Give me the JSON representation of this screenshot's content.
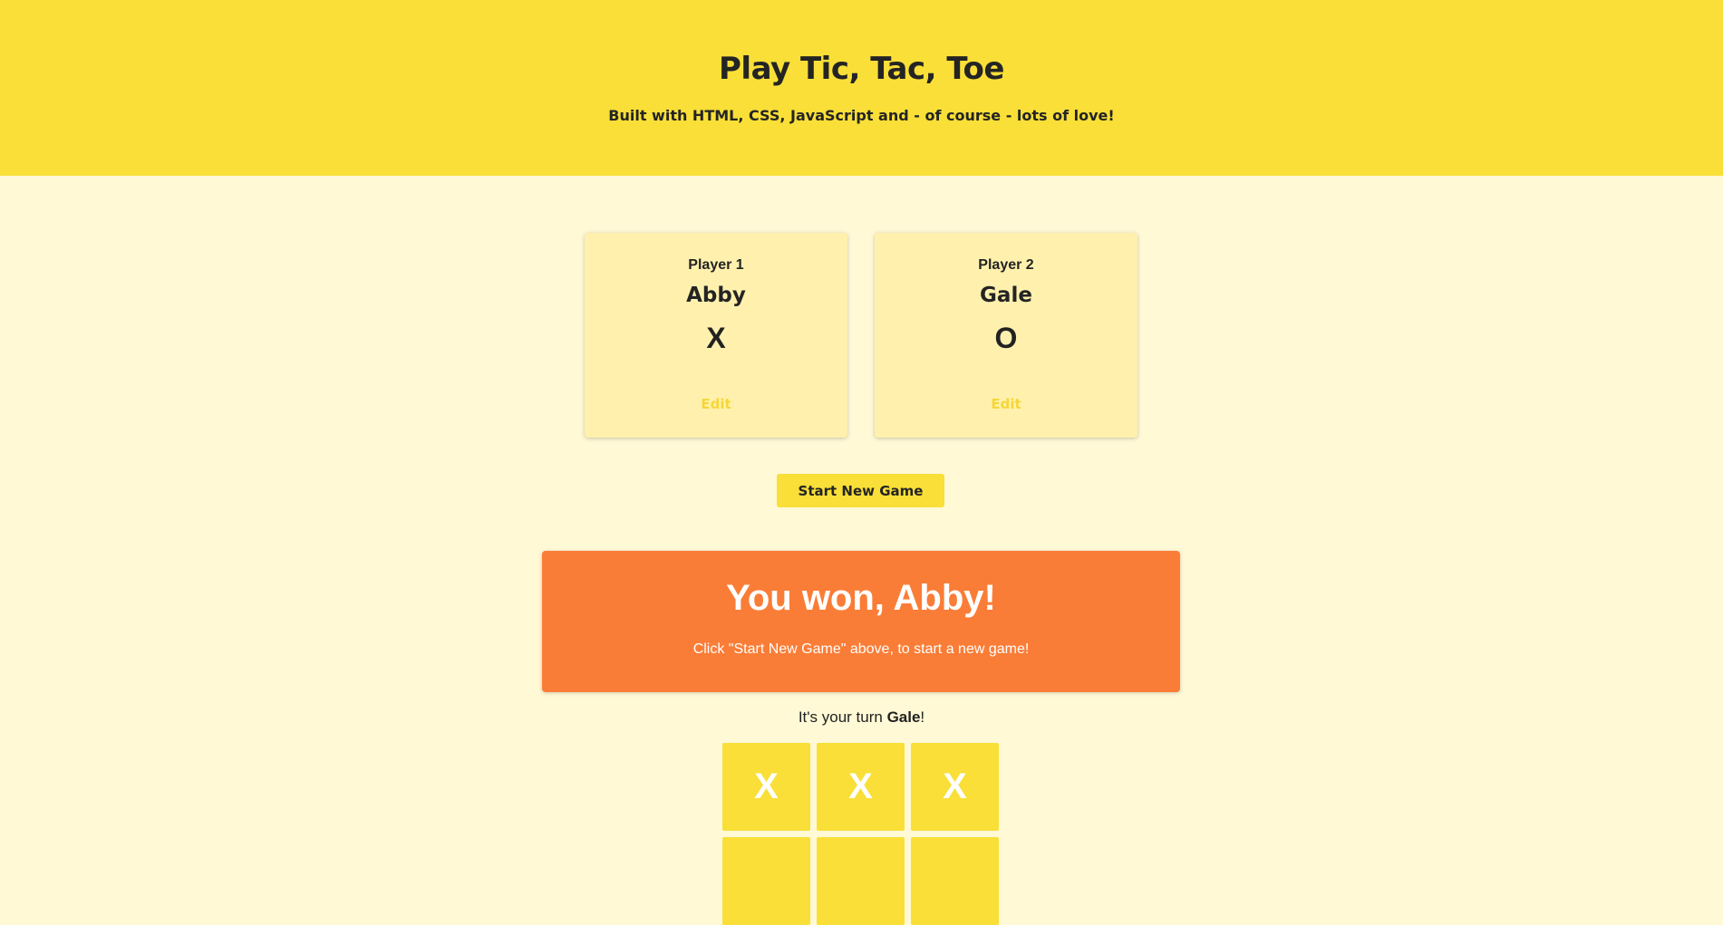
{
  "header": {
    "title": "Play Tic, Tac, Toe",
    "subtitle": "Built with HTML, CSS, JavaScript and - of course - lots of love!"
  },
  "players": [
    {
      "label": "Player 1",
      "name": "Abby",
      "symbol": "X",
      "edit_label": "Edit"
    },
    {
      "label": "Player 2",
      "name": "Gale",
      "symbol": "O",
      "edit_label": "Edit"
    }
  ],
  "start_button_label": "Start New Game",
  "game_over": {
    "title": "You won, Abby!",
    "message": "Click \"Start New Game\" above, to start a new game!"
  },
  "turn": {
    "prefix": "It's your turn ",
    "player": "Gale",
    "suffix": "!"
  },
  "board": {
    "cells": [
      "X",
      "X",
      "X",
      "",
      "",
      ""
    ]
  },
  "colors": {
    "header_bg": "#f9df37",
    "page_bg": "#fff9d6",
    "card_bg": "#fff1ad",
    "win_bg": "#fa7d37",
    "cell_bg": "#f9df37"
  }
}
